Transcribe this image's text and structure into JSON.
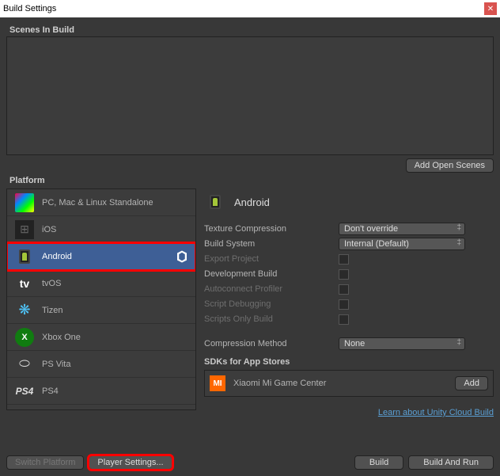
{
  "window": {
    "title": "Build Settings"
  },
  "scenes": {
    "header": "Scenes In Build",
    "add_open": "Add Open Scenes"
  },
  "platform_header": "Platform",
  "platforms": [
    {
      "name": "PC, Mac & Linux Standalone",
      "selected": false,
      "icon": "pc"
    },
    {
      "name": "iOS",
      "selected": false,
      "icon": "ios"
    },
    {
      "name": "Android",
      "selected": true,
      "icon": "android"
    },
    {
      "name": "tvOS",
      "selected": false,
      "icon": "tvos"
    },
    {
      "name": "Tizen",
      "selected": false,
      "icon": "tizen"
    },
    {
      "name": "Xbox One",
      "selected": false,
      "icon": "xbox"
    },
    {
      "name": "PS Vita",
      "selected": false,
      "icon": "psvita"
    },
    {
      "name": "PS4",
      "selected": false,
      "icon": "ps4"
    }
  ],
  "details": {
    "title": "Android",
    "rows": {
      "texture_compression": {
        "label": "Texture Compression",
        "value": "Don't override"
      },
      "build_system": {
        "label": "Build System",
        "value": "Internal (Default)"
      },
      "export_project": {
        "label": "Export Project"
      },
      "development_build": {
        "label": "Development Build"
      },
      "autoconnect_profiler": {
        "label": "Autoconnect Profiler"
      },
      "script_debugging": {
        "label": "Script Debugging"
      },
      "scripts_only_build": {
        "label": "Scripts Only Build"
      },
      "compression_method": {
        "label": "Compression Method",
        "value": "None"
      }
    },
    "sdk_header": "SDKs for App Stores",
    "sdk": {
      "name": "Xiaomi Mi Game Center",
      "add": "Add"
    },
    "cloud_link": "Learn about Unity Cloud Build"
  },
  "footer": {
    "switch_platform": "Switch Platform",
    "player_settings": "Player Settings...",
    "build": "Build",
    "build_and_run": "Build And Run"
  }
}
